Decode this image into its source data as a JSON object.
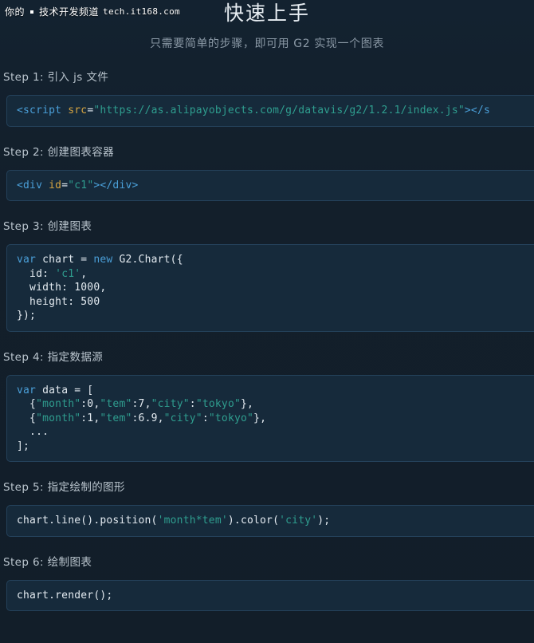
{
  "watermark": {
    "channel_text": "你的",
    "channel_name": "技术开发频道",
    "url": "tech.it168.com"
  },
  "header": {
    "title": "快速上手",
    "subtitle": "只需要简单的步骤，即可用 G2 实现一个图表"
  },
  "steps": [
    {
      "title": "Step 1: 引入 js 文件",
      "code_tokens": [
        {
          "text": "<script",
          "type": "tag"
        },
        {
          "text": " ",
          "type": "plain"
        },
        {
          "text": "src",
          "type": "attr"
        },
        {
          "text": "=",
          "type": "plain"
        },
        {
          "text": "\"https://as.alipayobjects.com/g/datavis/g2/1.2.1/index.js\"",
          "type": "str"
        },
        {
          "text": "></s",
          "type": "tag"
        }
      ],
      "code_plain": "<script src=\"https://as.alipayobjects.com/g/datavis/g2/1.2.1/index.js\"></s"
    },
    {
      "title": "Step 2: 创建图表容器",
      "code_tokens": [
        {
          "text": "<div",
          "type": "tag"
        },
        {
          "text": " ",
          "type": "plain"
        },
        {
          "text": "id",
          "type": "attr"
        },
        {
          "text": "=",
          "type": "plain"
        },
        {
          "text": "\"c1\"",
          "type": "str"
        },
        {
          "text": "></div>",
          "type": "tag"
        }
      ],
      "code_plain": "<div id=\"c1\"></div>"
    },
    {
      "title": "Step 3: 创建图表",
      "code_tokens": [
        {
          "text": "var",
          "type": "key"
        },
        {
          "text": " chart = ",
          "type": "plain"
        },
        {
          "text": "new",
          "type": "key"
        },
        {
          "text": " G2.Chart({\n  id: ",
          "type": "plain"
        },
        {
          "text": "'c1'",
          "type": "str"
        },
        {
          "text": ",\n  width: 1000,\n  height: 500\n});",
          "type": "plain"
        }
      ],
      "code_plain": "var chart = new G2.Chart({\n  id: 'c1',\n  width: 1000,\n  height: 500\n});"
    },
    {
      "title": "Step 4: 指定数据源",
      "code_tokens": [
        {
          "text": "var",
          "type": "key"
        },
        {
          "text": " data = [\n  {",
          "type": "plain"
        },
        {
          "text": "\"month\"",
          "type": "str"
        },
        {
          "text": ":0,",
          "type": "plain"
        },
        {
          "text": "\"tem\"",
          "type": "str"
        },
        {
          "text": ":7,",
          "type": "plain"
        },
        {
          "text": "\"city\"",
          "type": "str"
        },
        {
          "text": ":",
          "type": "plain"
        },
        {
          "text": "\"tokyo\"",
          "type": "str"
        },
        {
          "text": "},\n  {",
          "type": "plain"
        },
        {
          "text": "\"month\"",
          "type": "str"
        },
        {
          "text": ":1,",
          "type": "plain"
        },
        {
          "text": "\"tem\"",
          "type": "str"
        },
        {
          "text": ":6.9,",
          "type": "plain"
        },
        {
          "text": "\"city\"",
          "type": "str"
        },
        {
          "text": ":",
          "type": "plain"
        },
        {
          "text": "\"tokyo\"",
          "type": "str"
        },
        {
          "text": "},\n  ...\n];",
          "type": "plain"
        }
      ],
      "code_plain": "var data = [\n  {\"month\":0,\"tem\":7,\"city\":\"tokyo\"},\n  {\"month\":1,\"tem\":6.9,\"city\":\"tokyo\"},\n  ...\n];"
    },
    {
      "title": "Step 5: 指定绘制的图形",
      "code_tokens": [
        {
          "text": "chart.line().position(",
          "type": "plain"
        },
        {
          "text": "'month*tem'",
          "type": "str"
        },
        {
          "text": ").color(",
          "type": "plain"
        },
        {
          "text": "'city'",
          "type": "str"
        },
        {
          "text": ");",
          "type": "plain"
        }
      ],
      "code_plain": "chart.line().position('month*tem').color('city');"
    },
    {
      "title": "Step 6: 绘制图表",
      "code_tokens": [
        {
          "text": "chart.render();",
          "type": "plain"
        }
      ],
      "code_plain": "chart.render();"
    }
  ],
  "colors": {
    "page_background": "#131f2b",
    "code_background": "#162a3b",
    "code_border": "#24415a",
    "title": "#e8eef3",
    "subtitle": "#8a98a5",
    "step_title": "#b9c4cd",
    "token_keyword": "#4a9fd8",
    "token_attribute": "#d6a441",
    "token_string": "#2f9e8f",
    "token_plain": "#e3eaf0"
  }
}
